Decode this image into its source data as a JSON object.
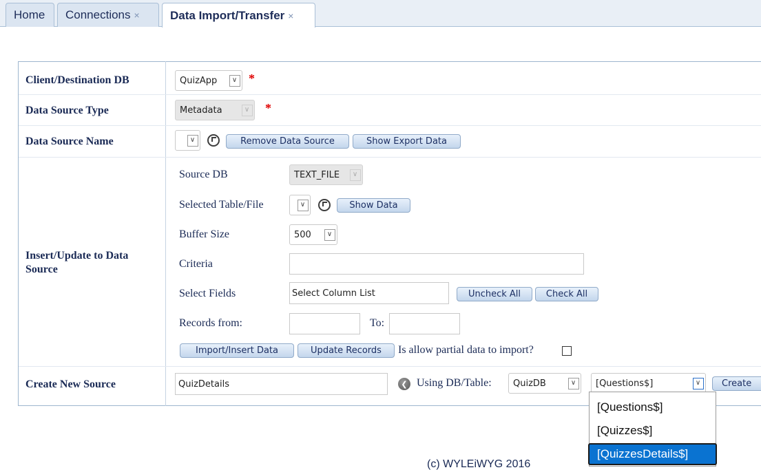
{
  "tabs": [
    {
      "label": "Home",
      "closable": false
    },
    {
      "label": "Connections",
      "closable": true
    },
    {
      "label": "Data Import/Transfer",
      "closable": true,
      "active": true
    }
  ],
  "close_glyph": "×",
  "form": {
    "client_db": {
      "label": "Client/Destination DB",
      "value": "QuizApp",
      "required": true
    },
    "source_type": {
      "label": "Data Source Type",
      "value": "Metadata",
      "required": true
    },
    "source_name": {
      "label": "Data Source Name",
      "value": "",
      "remove_button": "Remove Data Source",
      "export_button": "Show Export Data"
    },
    "insert_update": {
      "label": "Insert/Update to Data Source",
      "source_db": {
        "label": "Source DB",
        "value": "TEXT_FILE"
      },
      "selected_table": {
        "label": "Selected Table/File",
        "value": "",
        "show_button": "Show Data"
      },
      "buffer_size": {
        "label": "Buffer Size",
        "value": "500"
      },
      "criteria": {
        "label": "Criteria",
        "value": ""
      },
      "select_fields": {
        "label": "Select Fields",
        "value": "Select Column List",
        "uncheck_button": "Uncheck All",
        "check_button": "Check All"
      },
      "records": {
        "from_label": "Records from:",
        "from_value": "",
        "to_label": "To:",
        "to_value": ""
      },
      "import_button": "Import/Insert Data",
      "update_button": "Update Records",
      "partial_label": "Is allow partial data to import?",
      "partial_checked": false
    },
    "create_source": {
      "label": "Create New Source",
      "name_value": "QuizDetails",
      "using_label": "Using DB/Table:",
      "db_value": "QuizDB",
      "table_value": "[Questions$]",
      "create_button": "Create",
      "table_options": [
        "[Questions$]",
        "[Quizzes$]",
        "[QuizzesDetails$]"
      ],
      "highlighted_option": "[QuizzesDetails$]"
    }
  },
  "footer": "(c) WYLEiWYG 2016"
}
